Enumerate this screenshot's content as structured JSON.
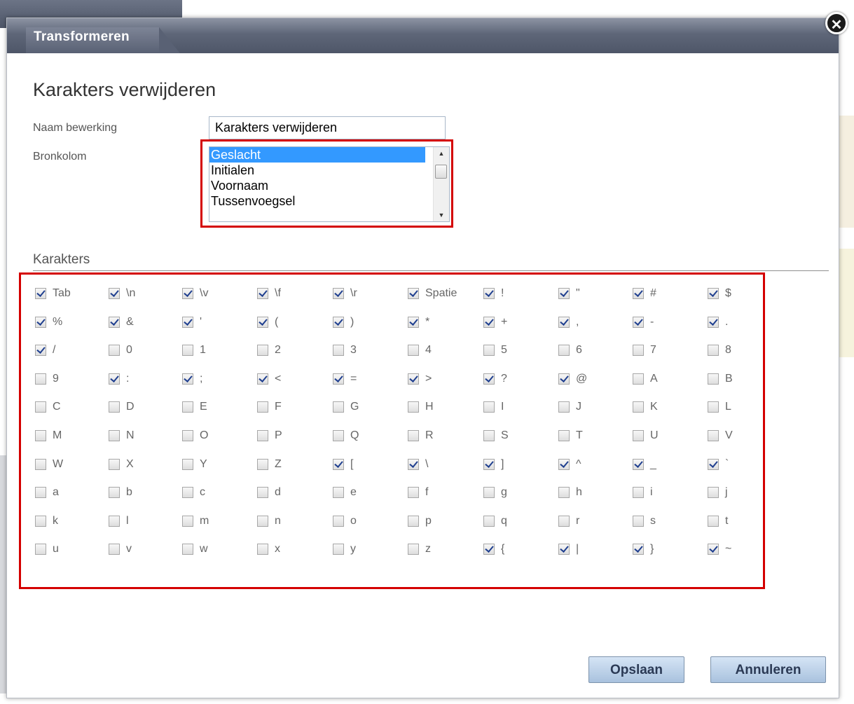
{
  "dialog": {
    "title": "Transformeren",
    "close_glyph": "✕",
    "heading": "Karakters verwijderen"
  },
  "form": {
    "name_label": "Naam bewerking",
    "name_value": "Karakters verwijderen",
    "source_label": "Bronkolom",
    "source_options": [
      "Geslacht",
      "Initialen",
      "Voornaam",
      "Tussenvoegsel"
    ],
    "source_selected": "Geslacht"
  },
  "characters": {
    "section_title": "Karakters",
    "rows": [
      [
        {
          "l": "Tab",
          "c": true
        },
        {
          "l": "\\n",
          "c": true
        },
        {
          "l": "\\v",
          "c": true
        },
        {
          "l": "\\f",
          "c": true
        },
        {
          "l": "\\r",
          "c": true
        },
        {
          "l": "Spatie",
          "c": true
        },
        {
          "l": "!",
          "c": true
        },
        {
          "l": "\"",
          "c": true
        },
        {
          "l": "#",
          "c": true
        },
        {
          "l": "$",
          "c": true
        }
      ],
      [
        {
          "l": "%",
          "c": true
        },
        {
          "l": "&",
          "c": true
        },
        {
          "l": "'",
          "c": true
        },
        {
          "l": "(",
          "c": true
        },
        {
          "l": ")",
          "c": true
        },
        {
          "l": "*",
          "c": true
        },
        {
          "l": "+",
          "c": true
        },
        {
          "l": ",",
          "c": true
        },
        {
          "l": "-",
          "c": true
        },
        {
          "l": ".",
          "c": true
        }
      ],
      [
        {
          "l": "/",
          "c": true
        },
        {
          "l": "0",
          "c": false
        },
        {
          "l": "1",
          "c": false
        },
        {
          "l": "2",
          "c": false
        },
        {
          "l": "3",
          "c": false
        },
        {
          "l": "4",
          "c": false
        },
        {
          "l": "5",
          "c": false
        },
        {
          "l": "6",
          "c": false
        },
        {
          "l": "7",
          "c": false
        },
        {
          "l": "8",
          "c": false
        }
      ],
      [
        {
          "l": "9",
          "c": false
        },
        {
          "l": ":",
          "c": true
        },
        {
          "l": ";",
          "c": true
        },
        {
          "l": "<",
          "c": true
        },
        {
          "l": "=",
          "c": true
        },
        {
          "l": ">",
          "c": true
        },
        {
          "l": "?",
          "c": true
        },
        {
          "l": "@",
          "c": true
        },
        {
          "l": "A",
          "c": false
        },
        {
          "l": "B",
          "c": false
        }
      ],
      [
        {
          "l": "C",
          "c": false
        },
        {
          "l": "D",
          "c": false
        },
        {
          "l": "E",
          "c": false
        },
        {
          "l": "F",
          "c": false
        },
        {
          "l": "G",
          "c": false
        },
        {
          "l": "H",
          "c": false
        },
        {
          "l": "I",
          "c": false
        },
        {
          "l": "J",
          "c": false
        },
        {
          "l": "K",
          "c": false
        },
        {
          "l": "L",
          "c": false
        }
      ],
      [
        {
          "l": "M",
          "c": false
        },
        {
          "l": "N",
          "c": false
        },
        {
          "l": "O",
          "c": false
        },
        {
          "l": "P",
          "c": false
        },
        {
          "l": "Q",
          "c": false
        },
        {
          "l": "R",
          "c": false
        },
        {
          "l": "S",
          "c": false
        },
        {
          "l": "T",
          "c": false
        },
        {
          "l": "U",
          "c": false
        },
        {
          "l": "V",
          "c": false
        }
      ],
      [
        {
          "l": "W",
          "c": false
        },
        {
          "l": "X",
          "c": false
        },
        {
          "l": "Y",
          "c": false
        },
        {
          "l": "Z",
          "c": false
        },
        {
          "l": "[",
          "c": true
        },
        {
          "l": "\\",
          "c": true
        },
        {
          "l": "]",
          "c": true
        },
        {
          "l": "^",
          "c": true
        },
        {
          "l": "_",
          "c": true
        },
        {
          "l": "`",
          "c": true
        }
      ],
      [
        {
          "l": "a",
          "c": false
        },
        {
          "l": "b",
          "c": false
        },
        {
          "l": "c",
          "c": false
        },
        {
          "l": "d",
          "c": false
        },
        {
          "l": "e",
          "c": false
        },
        {
          "l": "f",
          "c": false
        },
        {
          "l": "g",
          "c": false
        },
        {
          "l": "h",
          "c": false
        },
        {
          "l": "i",
          "c": false
        },
        {
          "l": "j",
          "c": false
        }
      ],
      [
        {
          "l": "k",
          "c": false
        },
        {
          "l": "l",
          "c": false
        },
        {
          "l": "m",
          "c": false
        },
        {
          "l": "n",
          "c": false
        },
        {
          "l": "o",
          "c": false
        },
        {
          "l": "p",
          "c": false
        },
        {
          "l": "q",
          "c": false
        },
        {
          "l": "r",
          "c": false
        },
        {
          "l": "s",
          "c": false
        },
        {
          "l": "t",
          "c": false
        }
      ],
      [
        {
          "l": "u",
          "c": false
        },
        {
          "l": "v",
          "c": false
        },
        {
          "l": "w",
          "c": false
        },
        {
          "l": "x",
          "c": false
        },
        {
          "l": "y",
          "c": false
        },
        {
          "l": "z",
          "c": false
        },
        {
          "l": "{",
          "c": true
        },
        {
          "l": "|",
          "c": true
        },
        {
          "l": "}",
          "c": true
        },
        {
          "l": "~",
          "c": true
        }
      ]
    ]
  },
  "buttons": {
    "save": "Opslaan",
    "cancel": "Annuleren"
  },
  "colors": {
    "highlight": "#d40000",
    "selection": "#3399ff",
    "titlebar": "#5e6678"
  }
}
